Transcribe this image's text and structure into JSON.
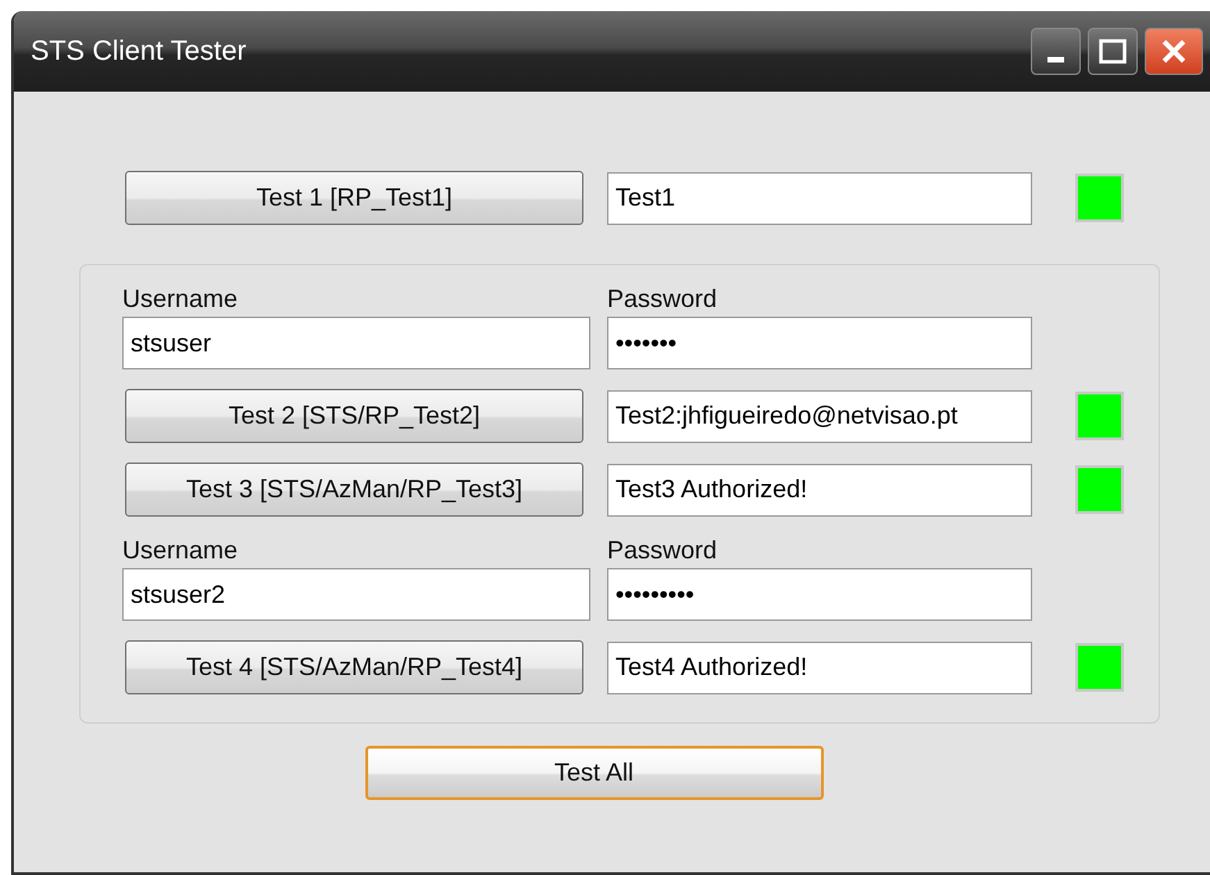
{
  "window": {
    "title": "STS Client Tester"
  },
  "top_test": {
    "button": "Test 1 [RP_Test1]",
    "result": "Test1",
    "color": "#00ff00"
  },
  "group": [
    {
      "kind": "credentials",
      "username_label": "Username",
      "username": "stsuser",
      "password_label": "Password",
      "password": "•••••••"
    },
    {
      "kind": "test",
      "button": "Test 2 [STS/RP_Test2]",
      "result": "Test2:jhfigueiredo@netvisao.pt",
      "color": "#00ff00"
    },
    {
      "kind": "test",
      "button": "Test 3 [STS/AzMan/RP_Test3]",
      "result": "Test3 Authorized!",
      "color": "#00ff00"
    },
    {
      "kind": "credentials",
      "username_label": "Username",
      "username": "stsuser2",
      "password_label": "Password",
      "password": "•••••••••"
    },
    {
      "kind": "test",
      "button": "Test 4 [STS/AzMan/RP_Test4]",
      "result": "Test4 Authorized!",
      "color": "#00ff00"
    }
  ],
  "test_all": {
    "label": "Test All",
    "focused": true
  }
}
